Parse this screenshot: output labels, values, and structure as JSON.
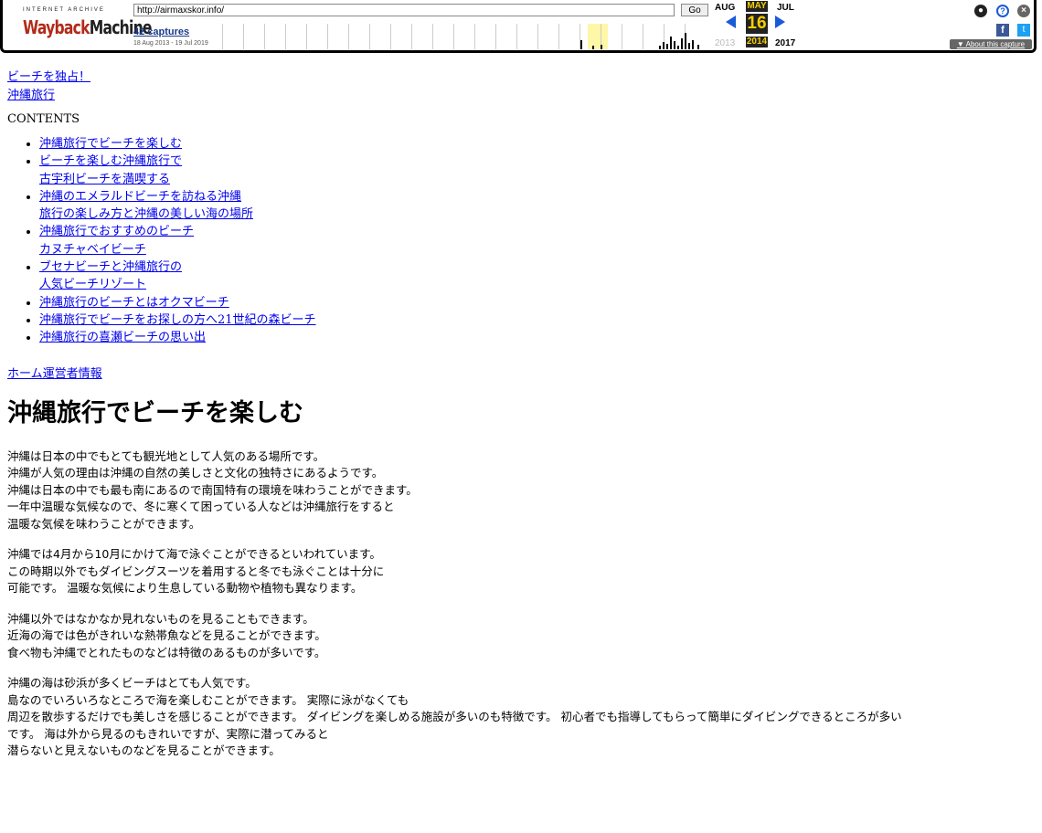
{
  "wayback": {
    "ia_text": "INTERNET ARCHIVE",
    "logo_red": "Wayback",
    "logo_dark": "Machine",
    "url": "http://airmaxskor.info/",
    "go_label": "Go",
    "captures": "42 captures",
    "capture_range": "18 Aug 2013 - 19 Jul 2019",
    "prev_month": "AUG",
    "cur_month": "MAY",
    "next_month": "JUL",
    "day": "16",
    "prev_year": "2013",
    "cur_year": "2014",
    "next_year": "2017",
    "about": "▼ About this capture",
    "user_icon": "user-icon",
    "help_icon": "help-icon",
    "close_icon": "close-icon",
    "facebook_icon": "facebook-icon",
    "twitter_icon": "twitter-icon",
    "accent": "#1a5ad8",
    "highlight": "#f5ce00"
  },
  "page": {
    "link1": "ビーチを独占！",
    "link2": "沖縄旅行",
    "contents_label": "CONTENTS",
    "toc": [
      {
        "l1": "沖縄旅行でビーチを楽しむ",
        "l2": ""
      },
      {
        "l1": "ビーチを楽しむ沖縄旅行で",
        "l2": "古宇利ビーチを満喫する"
      },
      {
        "l1": "沖縄のエメラルドビーチを訪ねる沖縄",
        "l2": "旅行の楽しみ方と沖縄の美しい海の場所"
      },
      {
        "l1": "沖縄旅行でおすすめのビーチ",
        "l2": "カヌチャベイビーチ"
      },
      {
        "l1": "ブセナビーチと沖縄旅行の",
        "l2": "人気ビーチリゾート"
      },
      {
        "l1": "沖縄旅行のビーチとはオクマビーチ",
        "l2": ""
      },
      {
        "l1": "沖縄旅行でビーチをお探しの方へ21世紀の森ビーチ",
        "l2": ""
      },
      {
        "l1": "沖縄旅行の喜瀬ビーチの思い出",
        "l2": ""
      }
    ],
    "home_link": "ホーム運営者情報",
    "heading": "沖縄旅行でビーチを楽しむ",
    "paragraphs": [
      "沖縄は日本の中でもとても観光地として人気のある場所です。\n沖縄が人気の理由は沖縄の自然の美しさと文化の独特さにあるようです。\n沖縄は日本の中でも最も南にあるので南国特有の環境を味わうことができます。\n一年中温暖な気候なので、冬に寒くて困っている人などは沖縄旅行をすると\n温暖な気候を味わうことができます。",
      "沖縄では4月から10月にかけて海で泳ぐことができるといわれています。\nこの時期以外でもダイビングスーツを着用すると冬でも泳ぐことは十分に\n可能です。 温暖な気候により生息している動物や植物も異なります。",
      "沖縄以外ではなかなか見れないものを見ることもできます。\n近海の海では色がきれいな熱帯魚などを見ることができます。\n食べ物も沖縄でとれたものなどは特徴のあるものが多いです。",
      "沖縄の海は砂浜が多くビーチはとても人気です。\n島なのでいろいろなところで海を楽しむことができます。 実際に泳がなくても\n周辺を散歩するだけでも美しさを感じることができます。 ダイビングを楽しめる施設が多いのも特徴です。 初心者でも指導してもらって簡単にダイビングできるところが多い\nです。 海は外から見るのもきれいですが、実際に潜ってみると\n潜らないと見えないものなどを見ることができます。"
    ]
  }
}
